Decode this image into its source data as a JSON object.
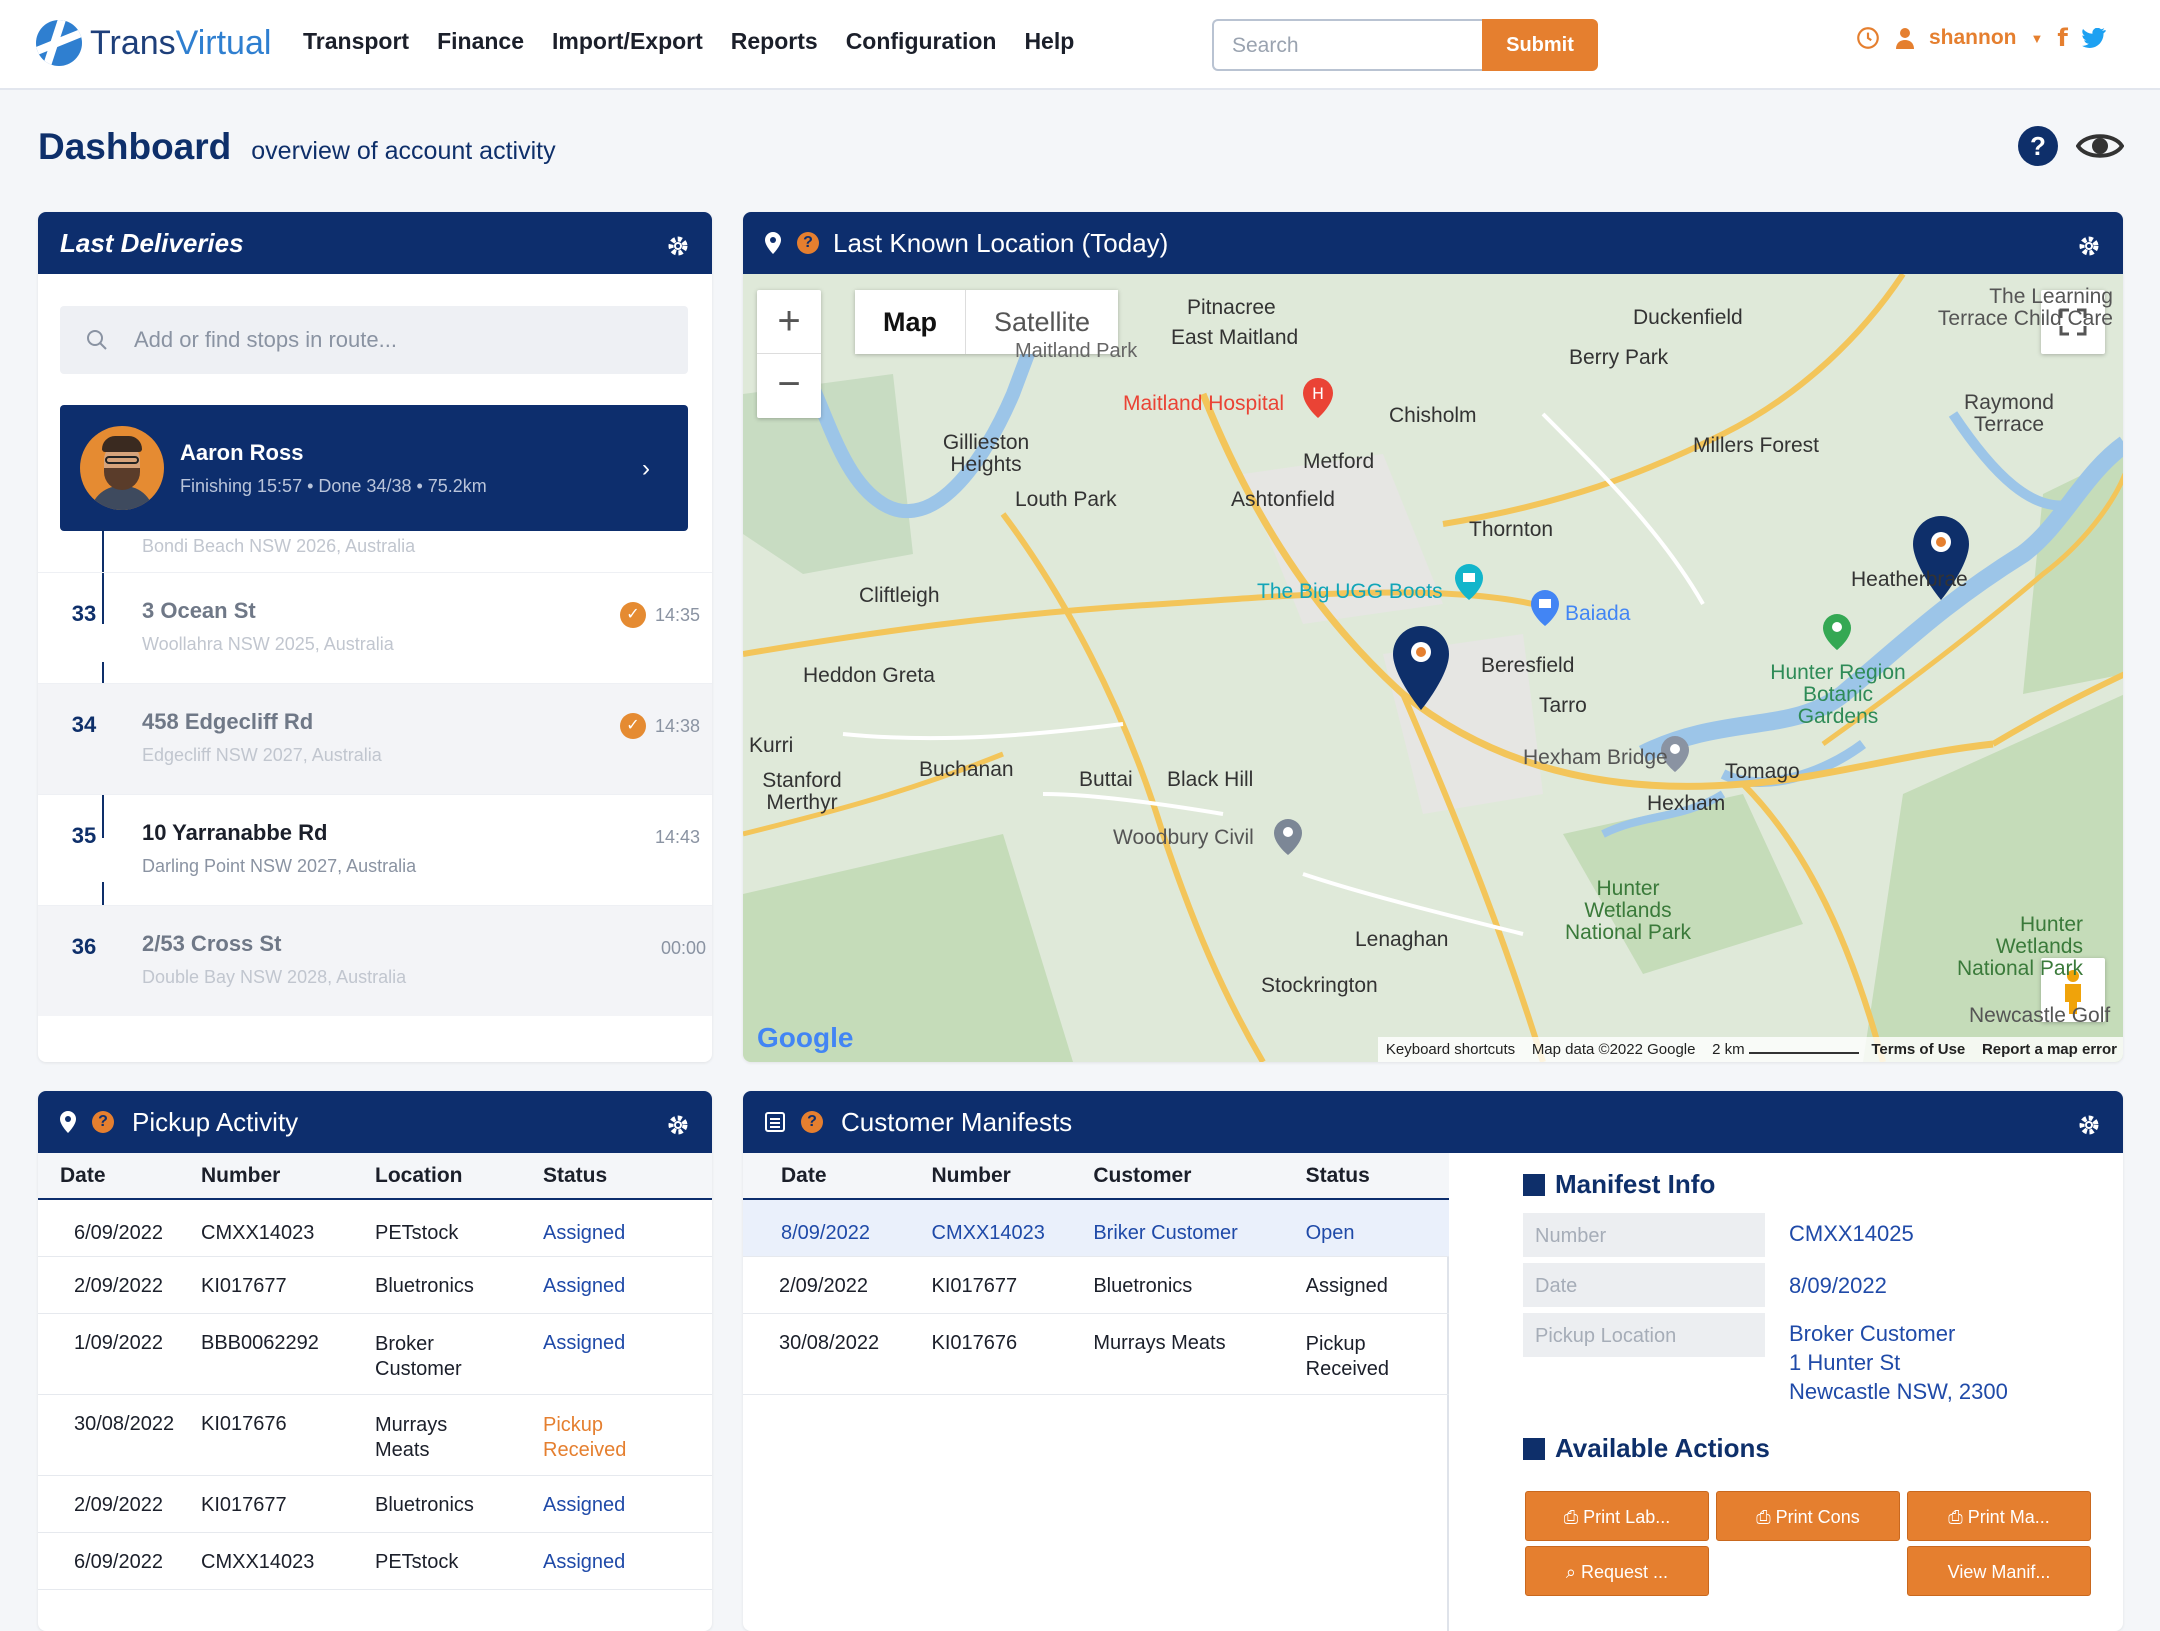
{
  "header": {
    "logo": {
      "part1": "Trans",
      "part2": "Virtual"
    },
    "nav": [
      "Transport",
      "Finance",
      "Import/Export",
      "Reports",
      "Configuration",
      "Help"
    ],
    "search": {
      "placeholder": "Search",
      "button": "Submit"
    },
    "user": "shannon"
  },
  "page": {
    "title": "Dashboard",
    "subtitle": "overview of account activity"
  },
  "deliveries": {
    "title": "Last Deliveries",
    "search_placeholder": "Add or find stops in route...",
    "driver": {
      "name": "Aaron Ross",
      "meta": "Finishing 15:57 • Done 34/38 • 75.2km"
    },
    "partial_addr": "Bondi Beach NSW 2026, Australia",
    "stops": [
      {
        "num": "33",
        "title": "3 Ocean St",
        "addr": "Woollahra NSW 2025, Australia",
        "time": "14:35",
        "done": true
      },
      {
        "num": "34",
        "title": "458 Edgecliff Rd",
        "addr": "Edgecliff NSW 2027, Australia",
        "time": "14:38",
        "done": true
      },
      {
        "num": "35",
        "title": "10 Yarranabbe Rd",
        "addr": "Darling Point NSW 2027, Australia",
        "time": "14:43",
        "done": false
      },
      {
        "num": "36",
        "title": "2/53 Cross St",
        "addr": "Double Bay NSW 2028, Australia",
        "time": "00:00",
        "done": false
      }
    ]
  },
  "map": {
    "title": "Last Known Location (Today)",
    "tabs": [
      "Map",
      "Satellite"
    ],
    "labels": {
      "l1": "Pitnacree",
      "l2": "East Maitland",
      "l3": "Maitland Park",
      "l4": "Maitland Hospital",
      "l5": "Duckenfield",
      "l6": "Berry Park",
      "l7": "Chisholm",
      "l8": "Gillieston Heights",
      "l9": "Metford",
      "l10": "Raymond Terrace",
      "l11": "Millers Forest",
      "l12": "Louth Park",
      "l13": "Ashtonfield",
      "l14": "Thornton",
      "l15": "Cliftleigh",
      "l16": "The Big UGG Boots",
      "l17": "Baiada",
      "l18": "Heddon Greta",
      "l19": "Beresfield",
      "l20": "Hunter Region Botanic Gardens",
      "l21": "Tarro",
      "l22": "Kurri",
      "l23": "Buchanan",
      "l24": "Hexham Bridge",
      "l25": "Tomago",
      "l26": "Stanford Merthyr",
      "l27": "Buttai",
      "l28": "Black Hill",
      "l29": "Hexham",
      "l30": "Woodbury Civil",
      "l31": "Hunter Wetlands National Park",
      "l32": "Lenaghan",
      "l33": "Stockrington",
      "l34": "Heatherbrae",
      "l35": "The Learning Terrace Child Care",
      "l36": "Hunter Wetlands National Park",
      "l37": "Newcastle Golf"
    },
    "footer": [
      "Keyboard shortcuts",
      "Map data ©2022 Google",
      "2 km",
      "Terms of Use",
      "Report a map error"
    ]
  },
  "pickup": {
    "title": "Pickup Activity",
    "columns": [
      "Date",
      "Number",
      "Location",
      "Status"
    ],
    "rows": [
      {
        "date": "6/09/2022",
        "number": "CMXX14023",
        "location": "PETstock",
        "status": "Assigned",
        "tone": "blue"
      },
      {
        "date": "2/09/2022",
        "number": "KI017677",
        "location": "Bluetronics",
        "status": "Assigned",
        "tone": "blue"
      },
      {
        "date": "1/09/2022",
        "number": "BBB0062292",
        "location": "Broker Customer",
        "status": "Assigned",
        "tone": "blue"
      },
      {
        "date": "30/08/2022",
        "number": "KI017676",
        "location": "Murrays Meats",
        "status": "Pickup Received",
        "tone": "orange"
      },
      {
        "date": "2/09/2022",
        "number": "KI017677",
        "location": "Bluetronics",
        "status": "Assigned",
        "tone": "blue"
      },
      {
        "date": "6/09/2022",
        "number": "CMXX14023",
        "location": "PETstock",
        "status": "Assigned",
        "tone": "blue"
      }
    ]
  },
  "manifests": {
    "title": "Customer Manifests",
    "columns": [
      "Date",
      "Number",
      "Customer",
      "Status"
    ],
    "rows": [
      {
        "date": "8/09/2022",
        "number": "CMXX14023",
        "customer": "Briker Customer",
        "status": "Open",
        "selected": true
      },
      {
        "date": "2/09/2022",
        "number": "KI017677",
        "customer": "Bluetronics",
        "status": "Assigned",
        "selected": false
      },
      {
        "date": "30/08/2022",
        "number": "KI017676",
        "customer": "Murrays Meats",
        "status": "Pickup Received",
        "selected": false
      }
    ],
    "info": {
      "title": "Manifest Info",
      "number_label": "Number",
      "number": "CMXX14025",
      "date_label": "Date",
      "date": "8/09/2022",
      "pickup_label": "Pickup Location",
      "pickup_line1": "Broker Customer",
      "pickup_line2": "1 Hunter St",
      "pickup_line3": "Newcastle NSW, 2300"
    },
    "actions": {
      "title": "Available Actions",
      "print_labels": "Print Lab...",
      "print_cons": "Print Cons",
      "print_manifest": "Print Ma...",
      "request": "Request ...",
      "view_manifest": "View Manif..."
    }
  },
  "colors": {
    "navy": "#0d2e6d",
    "orange": "#e57f2f",
    "link": "#1f4aa8"
  }
}
